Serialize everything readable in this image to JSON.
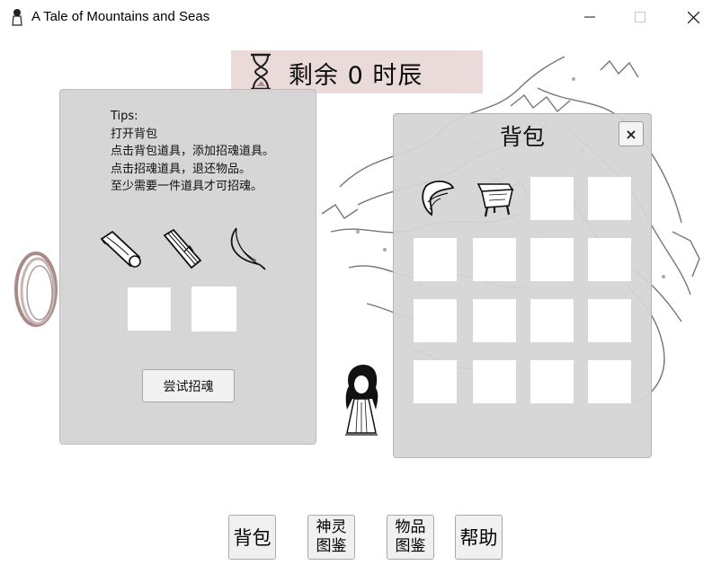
{
  "window": {
    "title": "A Tale of Mountains and Seas",
    "minimize_glyph": "—",
    "close_glyph": "✕"
  },
  "timer": {
    "text": "剩余 0 时辰"
  },
  "left_panel": {
    "tips": [
      "Tips:",
      "打开背包",
      "点击背包道具，添加招魂道具。",
      "点击招魂道具，退还物品。",
      "至少需要一件道具才可招魂。"
    ],
    "items": [
      "wooden-log-icon",
      "bamboo-slip-icon",
      "feather-icon"
    ],
    "summon_slots": 2,
    "summon_button": "尝试招魂"
  },
  "backpack": {
    "title": "背包",
    "close_label": "×",
    "cells": [
      {
        "item": "mirror-scroll-icon"
      },
      {
        "item": "bronze-cauldron-icon"
      },
      {
        "item": ""
      },
      {
        "item": ""
      },
      {
        "item": ""
      },
      {
        "item": ""
      },
      {
        "item": ""
      },
      {
        "item": ""
      },
      {
        "item": ""
      },
      {
        "item": ""
      },
      {
        "item": ""
      },
      {
        "item": ""
      },
      {
        "item": ""
      },
      {
        "item": ""
      },
      {
        "item": ""
      },
      {
        "item": ""
      }
    ]
  },
  "bottom_buttons": {
    "bag": "背包",
    "spirits_line1": "神灵",
    "spirits_line2": "图鉴",
    "items_line1": "物品",
    "items_line2": "图鉴",
    "help": "帮助"
  },
  "colors": {
    "panel": "#d2d2d2",
    "timer_banner": "#ead9d9",
    "portal_ring": "#b89a9a"
  }
}
